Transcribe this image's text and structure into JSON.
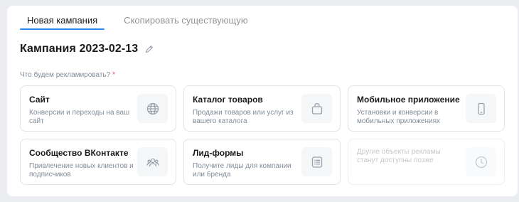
{
  "tabs": [
    {
      "label": "Новая кампания",
      "active": true
    },
    {
      "label": "Скопировать существующую",
      "active": false
    }
  ],
  "campaign_title": "Кампания 2023-02-13",
  "question": {
    "label": "Что будем рекламировать?",
    "required_mark": "*"
  },
  "cards": [
    {
      "title": "Сайт",
      "description": "Конверсии и переходы на ваш сайт",
      "icon": "globe-icon"
    },
    {
      "title": "Каталог товаров",
      "description": "Продажи товаров или услуг из вашего каталога",
      "icon": "shopping-bag-icon"
    },
    {
      "title": "Мобильное приложение",
      "description": "Установки и конверсии в мобильных приложениях",
      "icon": "smartphone-icon"
    },
    {
      "title": "Сообщество ВКонтакте",
      "description": "Привлечение новых клиентов и подписчиков",
      "icon": "users-icon"
    },
    {
      "title": "Лид-формы",
      "description": "Получите лиды для компании или бренда",
      "icon": "list-form-icon"
    },
    {
      "title": "",
      "description": "Другие объекты рекламы станут доступны позже",
      "icon": "clock-icon",
      "disabled": true
    }
  ],
  "colors": {
    "accent": "#2688eb",
    "required": "#e64646",
    "icon": "#99a2ad"
  }
}
